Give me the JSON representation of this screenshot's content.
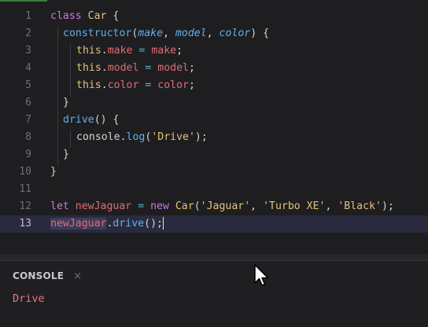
{
  "editor": {
    "active_line": 13,
    "lines": [
      {
        "num": "1"
      },
      {
        "num": "2"
      },
      {
        "num": "3"
      },
      {
        "num": "4"
      },
      {
        "num": "5"
      },
      {
        "num": "6"
      },
      {
        "num": "7"
      },
      {
        "num": "8"
      },
      {
        "num": "9"
      },
      {
        "num": "10"
      },
      {
        "num": "11"
      },
      {
        "num": "12"
      },
      {
        "num": "13"
      }
    ],
    "tokens": {
      "l1": [
        "class",
        " ",
        "Car",
        " {"
      ],
      "l2": [
        "constructor",
        "(",
        "make",
        ", ",
        "model",
        ", ",
        "color",
        ") {"
      ],
      "l3": [
        "this",
        ".",
        "make",
        " = ",
        "make",
        ";"
      ],
      "l4": [
        "this",
        ".",
        "model",
        " = ",
        "model",
        ";"
      ],
      "l5": [
        "this",
        ".",
        "color",
        " = ",
        "color",
        ";"
      ],
      "l6": [
        "}"
      ],
      "l7": [
        "drive",
        "() {"
      ],
      "l8": [
        "console",
        ".",
        "log",
        "(",
        "'Drive'",
        ");"
      ],
      "l9": [
        "}"
      ],
      "l10": [
        "}"
      ],
      "l12": [
        "let",
        " ",
        "newJaguar",
        " = ",
        "new",
        " ",
        "Car",
        "(",
        "'Jaguar'",
        ", ",
        "'Turbo XE'",
        ", ",
        "'Black'",
        ");"
      ],
      "l13": [
        "newJaguar",
        ".",
        "drive",
        "();"
      ]
    }
  },
  "console": {
    "tab_label": "CONSOLE",
    "close_glyph": "×",
    "output": "Drive"
  },
  "colors": {
    "background": "#1e1e20",
    "keyword": "#c678dd",
    "class_name": "#e5c07b",
    "function": "#61afef",
    "property": "#e06c75",
    "string": "#e5c07b",
    "console_output": "#e5787b"
  },
  "icons": {
    "close": "close-icon",
    "cursor": "mouse-pointer-icon"
  }
}
